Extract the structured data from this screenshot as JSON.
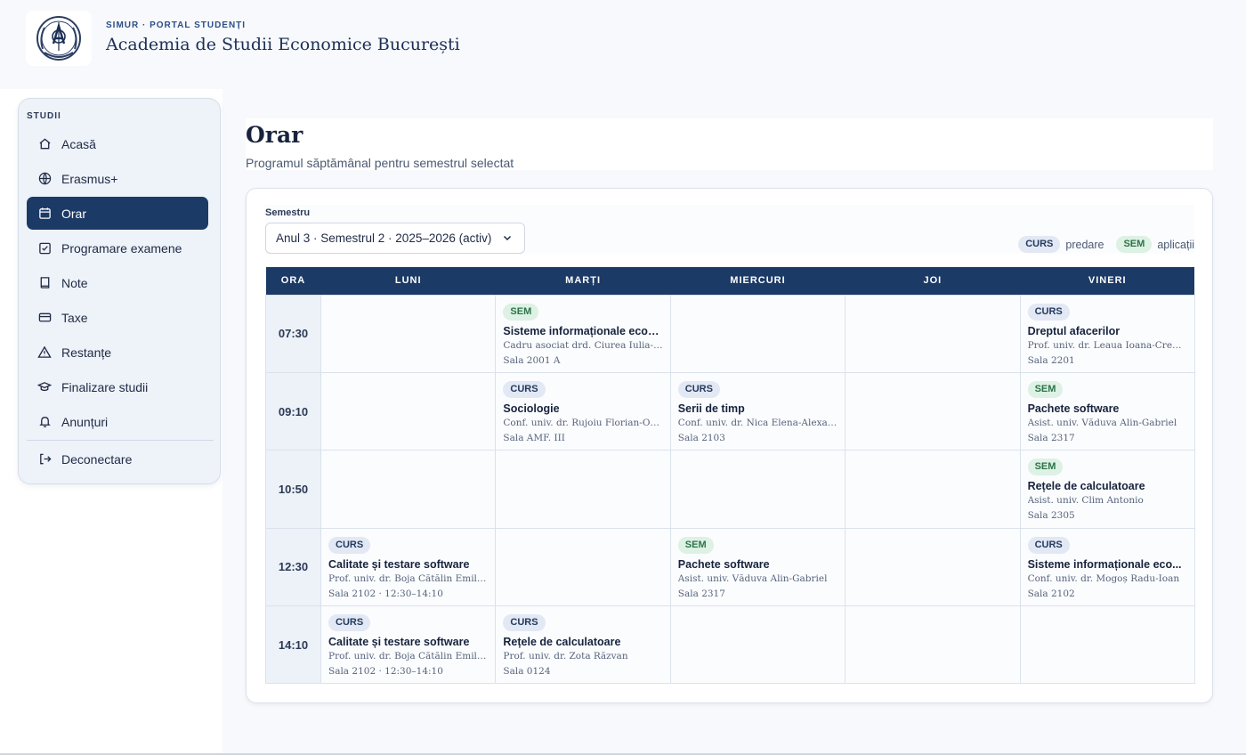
{
  "header": {
    "kicker": "SIMUR · PORTAL STUDENȚI",
    "title": "Academia de Studii Economice București"
  },
  "sidebar": {
    "heading": "STUDII",
    "items": [
      {
        "label": "Acasă",
        "icon": "home-icon"
      },
      {
        "label": "Erasmus+",
        "icon": "globe-icon"
      },
      {
        "label": "Orar",
        "icon": "calendar-icon",
        "active": true
      },
      {
        "label": "Programare examene",
        "icon": "calendar-check-icon"
      },
      {
        "label": "Note",
        "icon": "book-icon"
      },
      {
        "label": "Taxe",
        "icon": "credit-card-icon"
      },
      {
        "label": "Restanțe",
        "icon": "warning-icon"
      },
      {
        "label": "Finalizare studii",
        "icon": "graduation-cap-icon"
      },
      {
        "label": "Anunțuri",
        "icon": "bell-icon"
      }
    ],
    "logout": {
      "label": "Deconectare",
      "icon": "logout-icon"
    }
  },
  "page": {
    "title": "Orar",
    "subtitle": "Programul săptămânal pentru semestrul selectat"
  },
  "toolbar": {
    "semester_label": "Semestru",
    "semester_value": "Anul 3 · Semestrul 2 · 2025–2026 (activ)",
    "legend": [
      {
        "tag": "CURS",
        "text": "predare"
      },
      {
        "tag": "SEM",
        "text": "aplicații"
      }
    ]
  },
  "grid": {
    "headers": [
      "ORA",
      "LUNI",
      "MARȚI",
      "MIERCURI",
      "JOI",
      "VINERI"
    ],
    "rows": [
      {
        "time": "07:30",
        "cells": [
          null,
          {
            "type": "SEM",
            "title": "Sisteme informaționale econo...",
            "prof": "Cadru asociat drd. Ciurea Iulia-Cris...",
            "room": "Sala 2001 A"
          },
          null,
          null,
          {
            "type": "CURS",
            "title": "Dreptul afacerilor",
            "prof": "Prof. univ. dr. Leaua Ioana-Crenguța",
            "room": "Sala 2201"
          }
        ]
      },
      {
        "time": "09:10",
        "cells": [
          null,
          {
            "type": "CURS",
            "title": "Sociologie",
            "prof": "Conf. univ. dr. Rujoiu Florian-Octavi...",
            "room": "Sala AMF. III"
          },
          {
            "type": "CURS",
            "title": "Serii de timp",
            "prof": "Conf. univ. dr. Nica Elena-Alexandra",
            "room": "Sala 2103"
          },
          null,
          {
            "type": "SEM",
            "title": "Pachete software",
            "prof": "Asist. univ. Văduva Alin-Gabriel",
            "room": "Sala 2317"
          }
        ]
      },
      {
        "time": "10:50",
        "cells": [
          null,
          null,
          null,
          null,
          {
            "type": "SEM",
            "title": "Rețele de calculatoare",
            "prof": "Asist. univ. Clim Antonio",
            "room": "Sala 2305"
          }
        ]
      },
      {
        "time": "12:30",
        "cells": [
          {
            "type": "CURS",
            "title": "Calitate și testare software",
            "prof": "Prof. univ. dr. Boja Cătălin Emilian",
            "room": "Sala 2102 · 12:30–14:10"
          },
          null,
          {
            "type": "SEM",
            "title": "Pachete software",
            "prof": "Asist. univ. Văduva Alin-Gabriel",
            "room": "Sala 2317"
          },
          null,
          {
            "type": "CURS",
            "title": "Sisteme informaționale eco...",
            "prof": "Conf. univ. dr. Mogoș Radu-Ioan",
            "room": "Sala 2102"
          }
        ]
      },
      {
        "time": "14:10",
        "cells": [
          {
            "type": "CURS",
            "title": "Calitate și testare software",
            "prof": "Prof. univ. dr. Boja Cătălin Emilian",
            "room": "Sala 2102 · 12:30–14:10"
          },
          {
            "type": "CURS",
            "title": "Rețele de calculatoare",
            "prof": "Prof. univ. dr. Zota Răzvan",
            "room": "Sala 0124"
          },
          null,
          null,
          null
        ]
      }
    ]
  },
  "colors": {
    "primary": "#1c3a66",
    "curs_bg": "#e2e8f4",
    "sem_bg": "#ddf1e4",
    "sem_text": "#2c7348"
  }
}
